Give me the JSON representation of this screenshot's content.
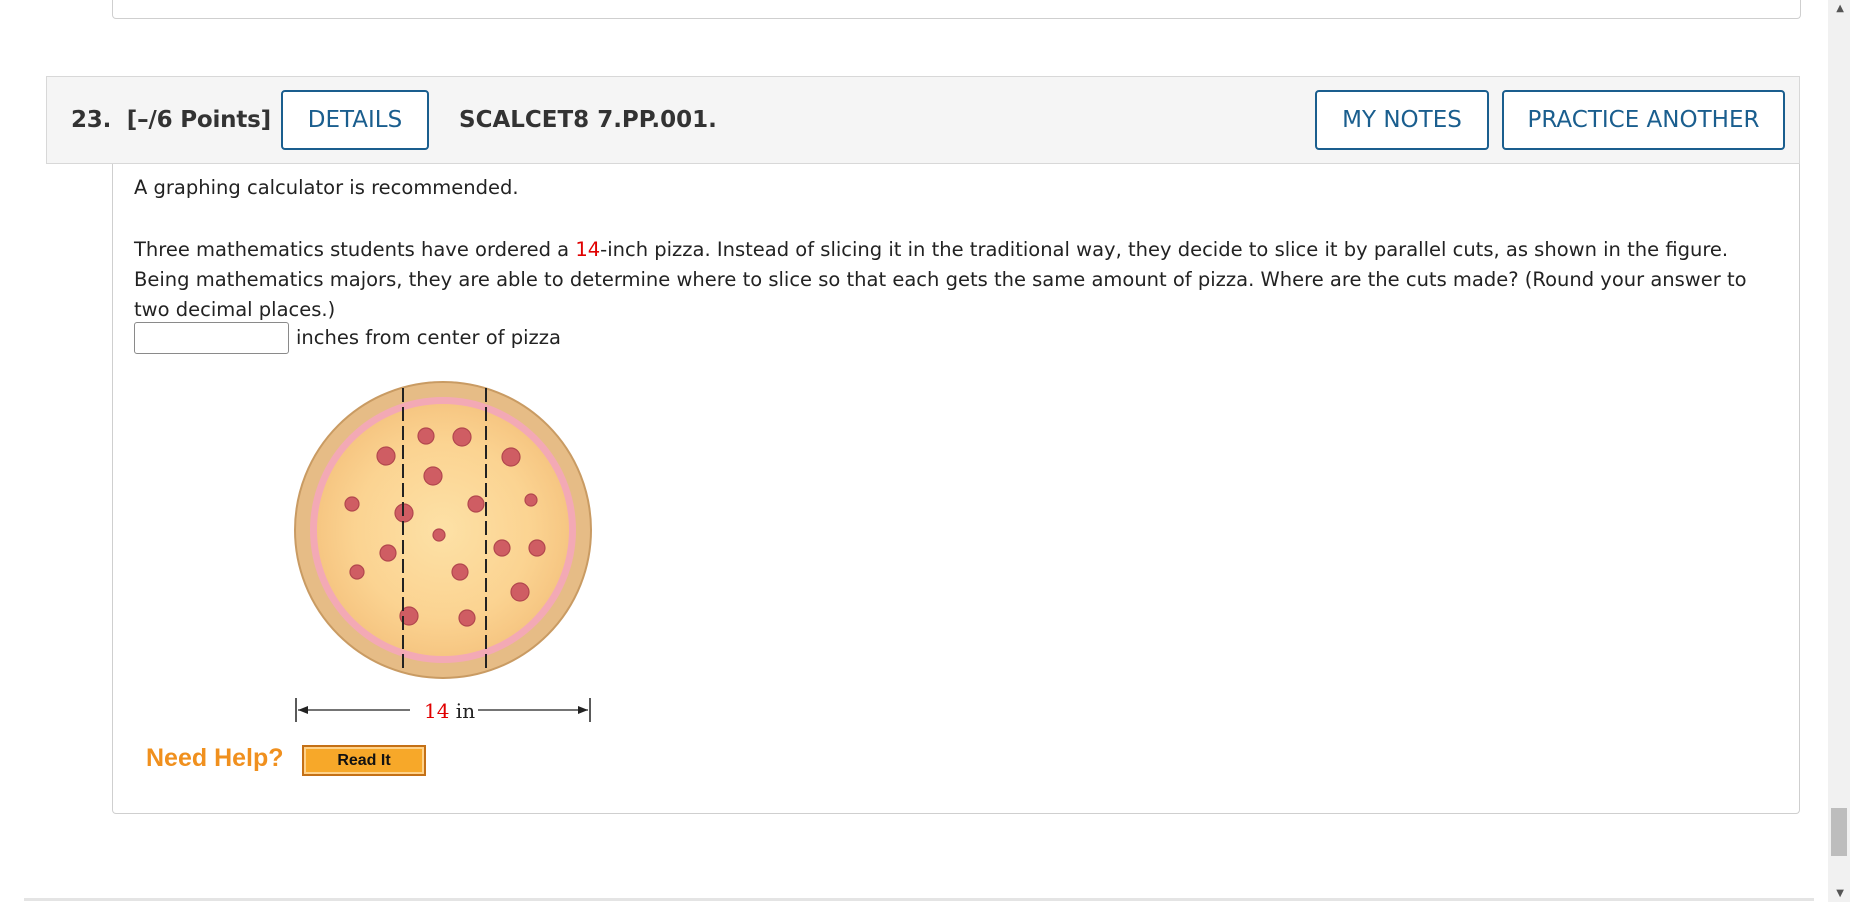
{
  "question": {
    "number": "23.",
    "points": "[–/6 Points]",
    "details_label": "DETAILS",
    "code": "SCALCET8 7.PP.001.",
    "my_notes_label": "MY NOTES",
    "practice_label": "PRACTICE ANOTHER",
    "calculator_note": "A graphing calculator is recommended.",
    "text_part1": "Three mathematics students have ordered a ",
    "pizza_size": "14",
    "text_part2": "-inch pizza. Instead of slicing it in the traditional way, they decide to slice it by parallel cuts, as shown in the figure. Being mathematics majors, they are able to determine where to slice so that each gets the same amount of pizza. Where are the cuts made? (Round your answer to two decimal places.)",
    "answer_value": "",
    "answer_units": "inches from center of pizza",
    "figure_dim_value": "14",
    "figure_dim_unit": " in",
    "need_help_label": "Need Help?",
    "read_it_label": "Read It"
  },
  "colors": {
    "accent": "#1a5e8e",
    "highlight_red": "#e00000",
    "help_orange": "#f0901e"
  }
}
